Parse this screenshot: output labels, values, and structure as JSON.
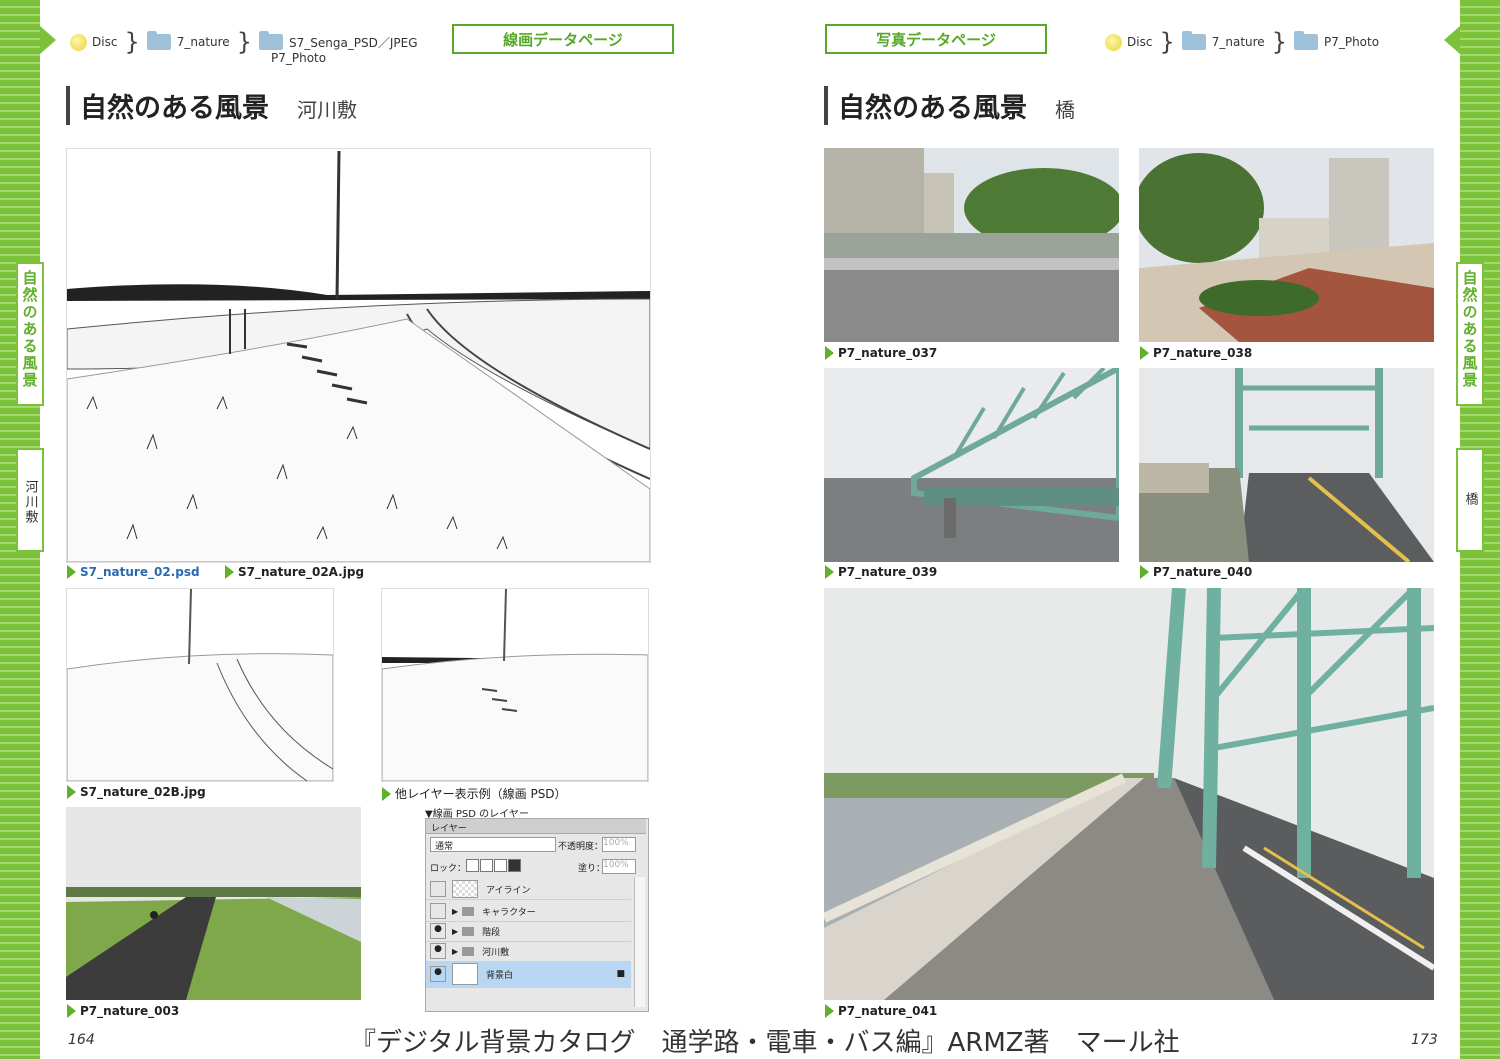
{
  "breadcrumb_left": {
    "disc": "Disc",
    "folder1": "7_nature",
    "folder2": "S7_Senga_PSD／JPEG",
    "folder3": "P7_Photo"
  },
  "breadcrumb_right": {
    "disc": "Disc",
    "folder1": "7_nature",
    "folder2": "P7_Photo"
  },
  "buttons": {
    "left": "線画データページ",
    "right": "写真データページ"
  },
  "left_title": {
    "main": "自然のある風景",
    "sub": "河川敷"
  },
  "right_title": {
    "main": "自然のある風景",
    "sub": "橋"
  },
  "side_tabs": {
    "left_main": "自然のある風景",
    "left_sub": "河川敷",
    "right_main": "自然のある風景",
    "right_sub": "橋"
  },
  "captions": {
    "c1": "S7_nature_02.psd",
    "c2": "S7_nature_02A.jpg",
    "c3": "S7_nature_02B.jpg",
    "c4": "他レイヤー表示例（線画 PSD）",
    "c5": "P7_nature_003",
    "r1": "P7_nature_037",
    "r2": "P7_nature_038",
    "r3": "P7_nature_039",
    "r4": "P7_nature_040",
    "r5": "P7_nature_041"
  },
  "layers_panel": {
    "caption": "▼線画 PSD のレイヤー",
    "tab": "レイヤー",
    "mode": "通常",
    "opacity_label": "不透明度：",
    "opacity": "100%",
    "lock_label": "ロック：",
    "fill_label": "塗り：",
    "fill": "100%",
    "layers": [
      "アイライン",
      "キャラクター",
      "階段",
      "河川敷",
      "背景白"
    ]
  },
  "page_numbers": {
    "left": "164",
    "right": "173"
  },
  "footer": "『デジタル背景カタログ　通学路・電車・バス編』ARMZ著　マール社"
}
